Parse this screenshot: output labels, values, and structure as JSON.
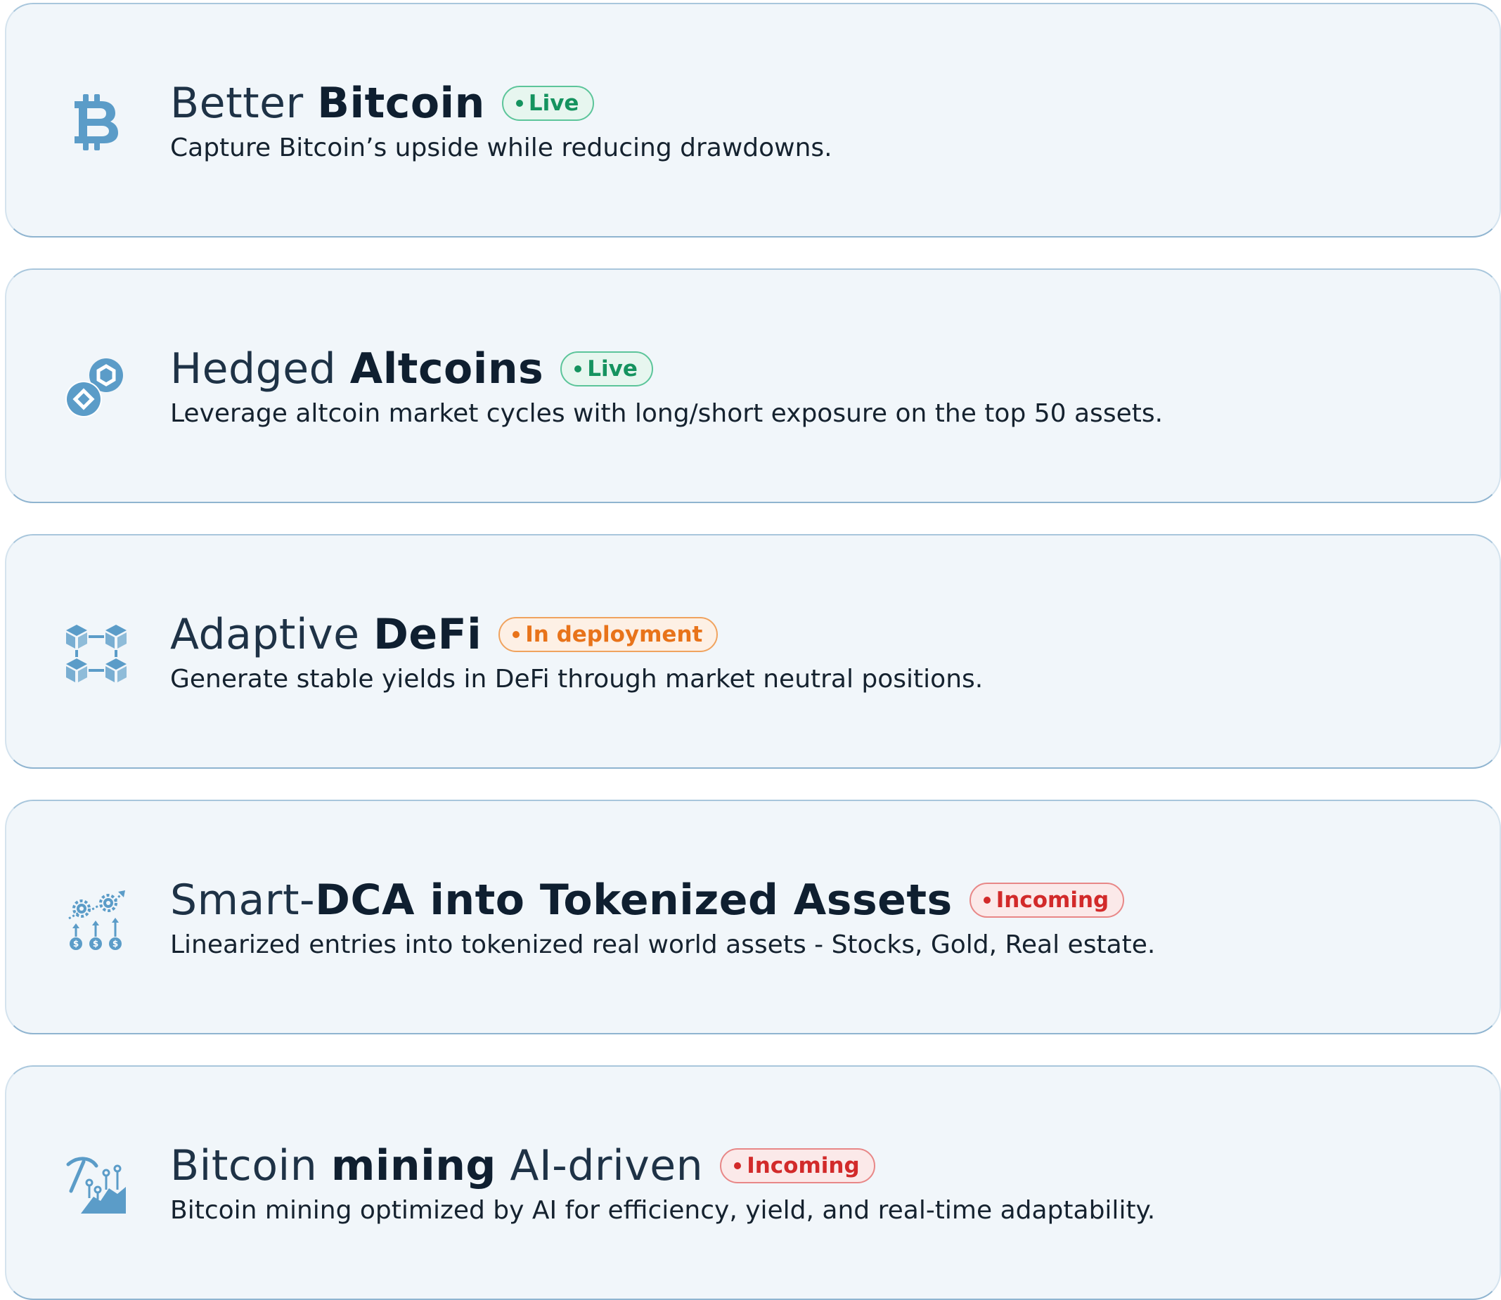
{
  "colors": {
    "card_background": "#f1f6fa",
    "icon": "#5b9cc8",
    "title": "#1e3246",
    "live": "#15935f",
    "in_deployment": "#e8731a",
    "incoming": "#d22a2a"
  },
  "cards": [
    {
      "icon": "bitcoin-icon",
      "title_regular": "Better ",
      "title_strong": "Bitcoin",
      "title_suffix": "",
      "status": "Live",
      "description": "Capture Bitcoin’s upside while reducing drawdowns."
    },
    {
      "icon": "coins-icon",
      "title_regular": "Hedged ",
      "title_strong": "Altcoins",
      "title_suffix": "",
      "status": "Live",
      "description": "Leverage altcoin market cycles with long/short exposure on the top 50 assets."
    },
    {
      "icon": "blockchain-icon",
      "title_regular": "Adaptive ",
      "title_strong": "DeFi",
      "title_suffix": "",
      "status": "In deployment",
      "description": "Generate stable yields in DeFi through market neutral positions."
    },
    {
      "icon": "investment-growth-icon",
      "title_regular": "Smart-",
      "title_strong": "DCA into Tokenized Assets",
      "title_suffix": "",
      "status": "Incoming",
      "description": "Linearized entries into tokenized real world assets - Stocks, Gold, Real estate."
    },
    {
      "icon": "mining-icon",
      "title_regular": "Bitcoin ",
      "title_strong": "mining",
      "title_suffix": " AI-driven",
      "status": "Incoming",
      "description": "Bitcoin mining optimized by AI for efficiency, yield, and real-time adaptability."
    }
  ]
}
